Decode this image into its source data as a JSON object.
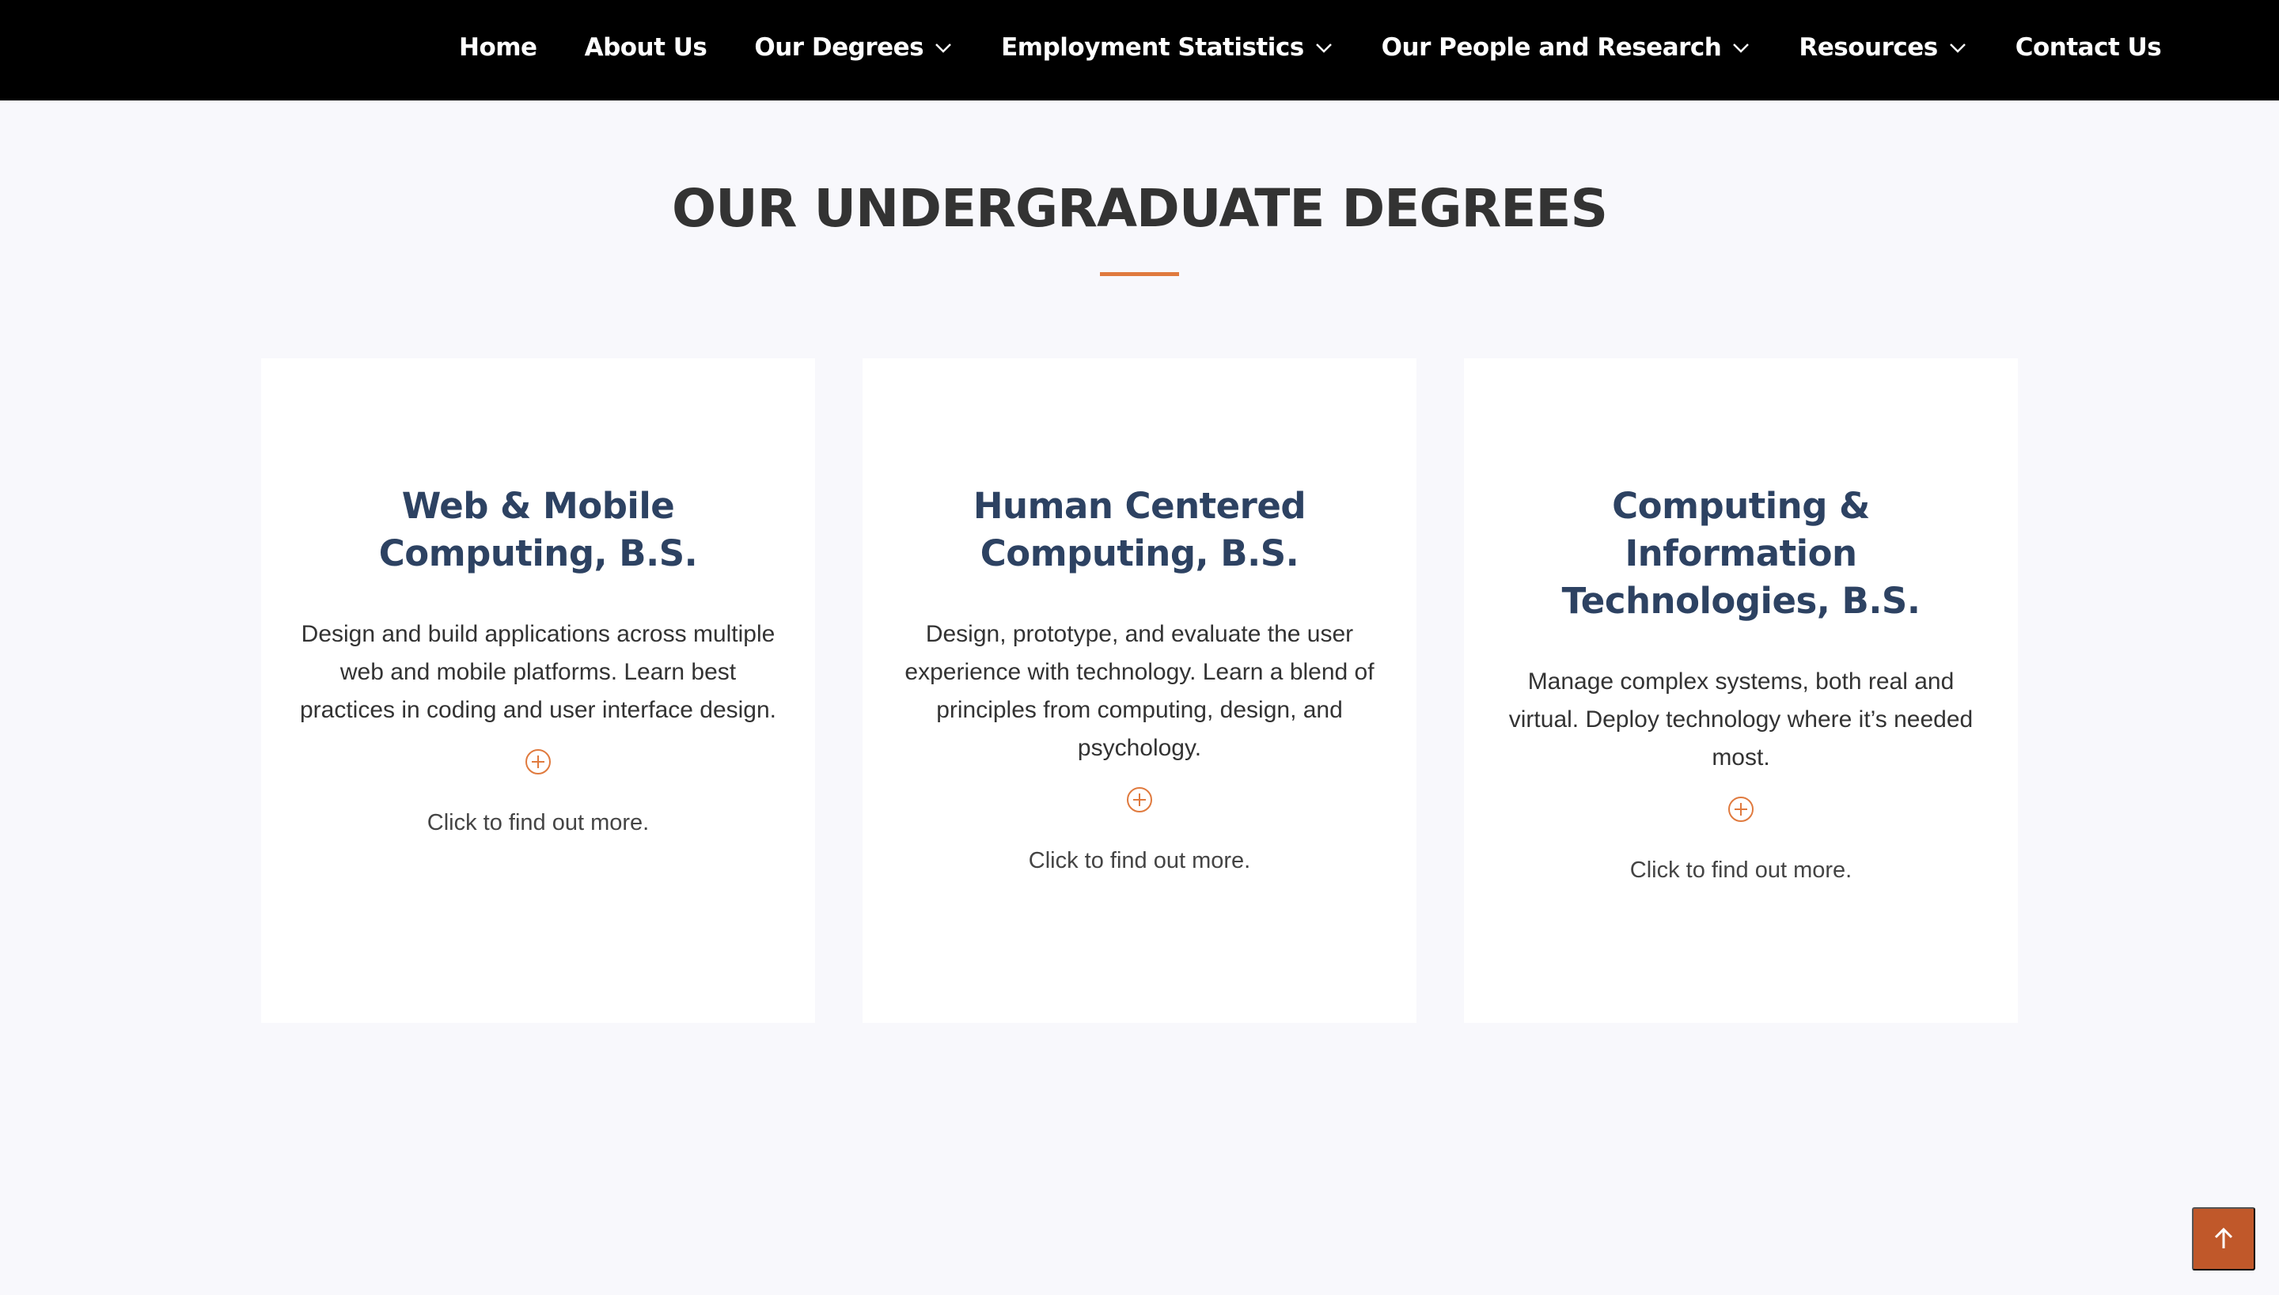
{
  "nav": {
    "items": [
      {
        "label": "Home",
        "dropdown": false
      },
      {
        "label": "About Us",
        "dropdown": false
      },
      {
        "label": "Our Degrees",
        "dropdown": true
      },
      {
        "label": "Employment Statistics",
        "dropdown": true
      },
      {
        "label": "Our People and Research",
        "dropdown": true
      },
      {
        "label": "Resources",
        "dropdown": true
      },
      {
        "label": "Contact Us",
        "dropdown": false
      }
    ]
  },
  "section": {
    "title": "OUR UNDERGRADUATE DEGREES"
  },
  "degrees": [
    {
      "title": "Web & Mobile Computing, B.S.",
      "description": "Design and build applications across multiple web and mobile platforms. Learn best practices in coding and user interface design.",
      "icon": "plus-circle-icon",
      "link": "Click to find out more."
    },
    {
      "title": "Human Centered Computing, B.S.",
      "description": "Design, prototype, and evaluate the user experience with technology. Learn a blend of principles from computing, design, and psychology.",
      "icon": "plus-circle-icon",
      "link": "Click to find out more."
    },
    {
      "title": "Computing & Information Technologies, B.S.",
      "description": "Manage complex systems, both real and virtual. Deploy technology where it’s needed most.",
      "icon": "plus-circle-icon",
      "link": "Click to find out more."
    }
  ],
  "scroll_top": {
    "icon": "arrow-up-icon"
  },
  "colors": {
    "nav_bg": "#000000",
    "accent": "#e07a3e",
    "title_text": "#2d4262",
    "scroll_button": "#c0582a",
    "page_bg": "#f8f8fc"
  }
}
